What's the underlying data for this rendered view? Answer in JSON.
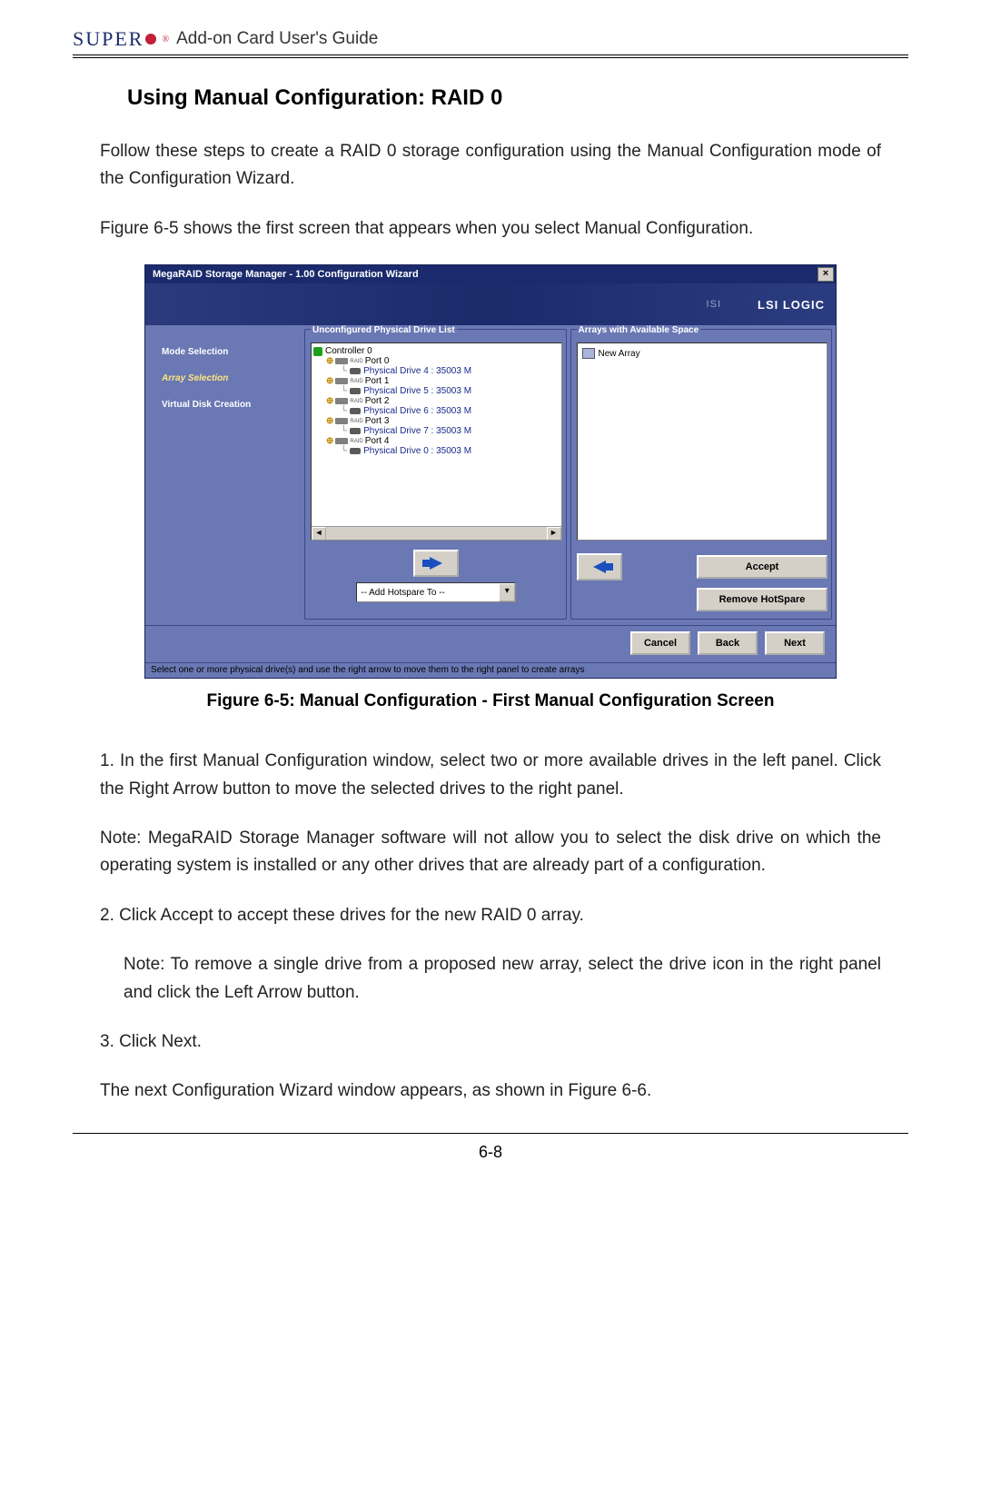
{
  "header": {
    "brand": "SUPER",
    "guide": "Add-on Card User's Guide"
  },
  "section_heading": "Using Manual Configuration: RAID 0",
  "paras": {
    "intro": "Follow these steps to create a RAID 0 storage configuration using the Manual Configuration mode of the Configuration Wizard.",
    "fig_ref": "Figure 6-5 shows the first screen that appears when you select Manual Configuration.",
    "step1": "1. In the first Manual Configuration window, select two or more available drives in the left panel. Click the Right Arrow button to move the selected drives to the right panel.",
    "note1": "Note: MegaRAID Storage Manager software will not allow you to select the disk drive on which the operating system is installed or any other drives that are already part of a configuration.",
    "step2": "2. Click Accept to accept these drives for the new RAID 0 array.",
    "note2": "Note: To remove a single drive from a proposed new array, select the drive icon in the right panel and click the Left Arrow button.",
    "step3": "3. Click Next.",
    "outro": "The next Configuration Wizard window appears, as shown in Figure 6-6."
  },
  "figure_caption": "Figure 6-5: Manual Configuration - First Manual Configuration Screen",
  "page_number": "6-8",
  "screenshot": {
    "title": "MegaRAID Storage Manager - 1.00 Configuration Wizard",
    "banner_right": "LSI LOGIC",
    "steps": {
      "mode": "Mode Selection",
      "array": "Array Selection",
      "vdisk": "Virtual Disk Creation"
    },
    "mid_label": "Unconfigured Physical Drive List",
    "right_label": "Arrays with Available Space",
    "controller": "Controller 0",
    "ports": [
      {
        "port": "Port 0",
        "drive": "Physical Drive 4 : 35003 M"
      },
      {
        "port": "Port 1",
        "drive": "Physical Drive 5 : 35003 M"
      },
      {
        "port": "Port 2",
        "drive": "Physical Drive 6 : 35003 M"
      },
      {
        "port": "Port 3",
        "drive": "Physical Drive 7 : 35003 M"
      },
      {
        "port": "Port 4",
        "drive": "Physical Drive 0 : 35003 M"
      }
    ],
    "new_array": "New Array",
    "combo_text": "-- Add Hotspare To --",
    "accept_btn": "Accept",
    "remove_btn": "Remove HotSpare",
    "cancel_btn": "Cancel",
    "back_btn": "Back",
    "next_btn": "Next",
    "status": "Select one or more physical drive(s) and use the right arrow to move them to the right panel to create arrays"
  }
}
